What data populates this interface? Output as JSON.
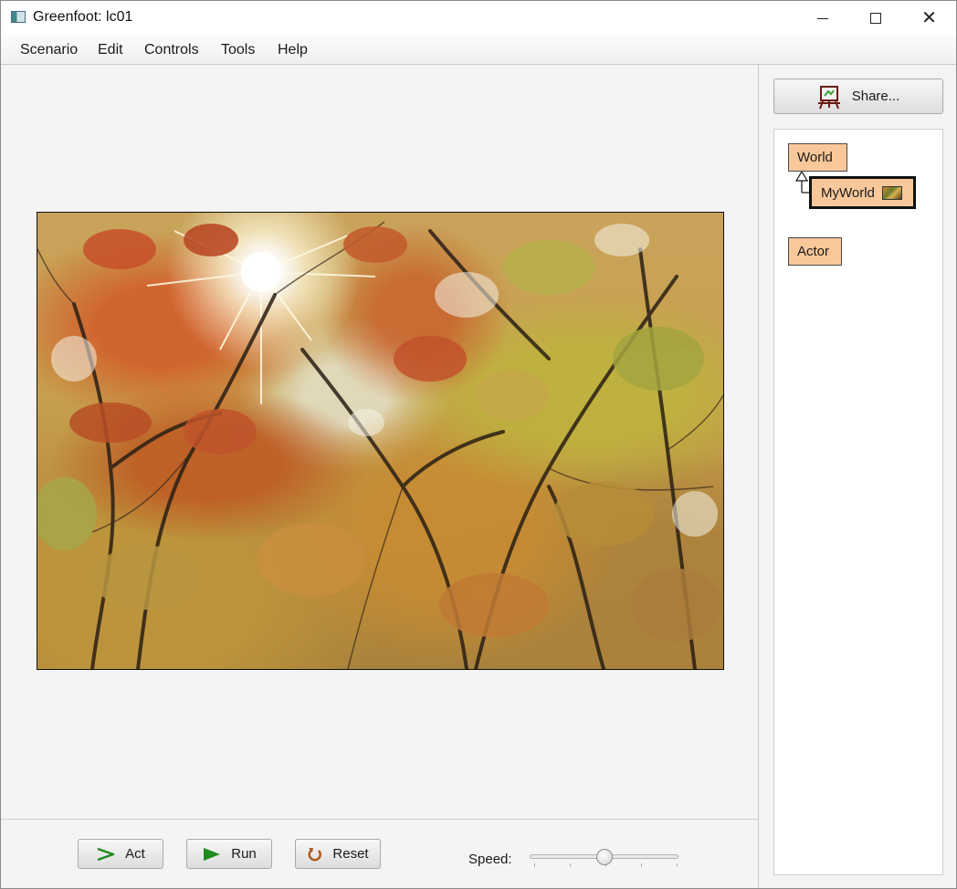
{
  "window": {
    "title": "Greenfoot: lc01",
    "minimize_icon": "minimize-icon",
    "maximize_icon": "maximize-icon",
    "close_icon": "close-icon",
    "close_glyph": "✕"
  },
  "menu": {
    "items": [
      "Scenario",
      "Edit",
      "Controls",
      "Tools",
      "Help"
    ]
  },
  "world": {
    "image": "autumn-trees-canopy-sunburst"
  },
  "controls": {
    "act_label": "Act",
    "run_label": "Run",
    "reset_label": "Reset",
    "speed_label": "Speed:",
    "speed_value_fraction": 0.5,
    "act_icon": "step-arrow-icon",
    "run_icon": "play-icon",
    "reset_icon": "reset-icon"
  },
  "sidebar": {
    "share_label": "Share...",
    "share_icon": "share-easel-icon",
    "classes": {
      "world": "World",
      "myworld": "MyWorld",
      "actor": "Actor"
    },
    "class_color": "#f9c89a"
  }
}
